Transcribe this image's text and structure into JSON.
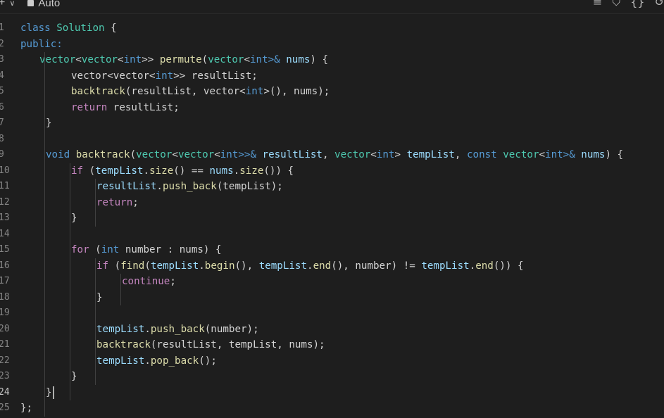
{
  "toolbar": {
    "add_glyph": "+",
    "dropdown_glyph": "∨",
    "language": "Auto",
    "format_glyph": "≡",
    "bookmark_glyph": "⛉",
    "braces_glyph": "{}",
    "reset_glyph": "↺"
  },
  "editor": {
    "active_line": 24,
    "lines": [
      {
        "num": "1",
        "indent": 0,
        "tokens": [
          {
            "t": "class ",
            "c": "kw"
          },
          {
            "t": "Solution",
            "c": "ty"
          },
          {
            "t": " {",
            "c": "pn"
          }
        ]
      },
      {
        "num": "2",
        "indent": 0,
        "tokens": [
          {
            "t": "public:",
            "c": "kw"
          }
        ]
      },
      {
        "num": "3",
        "indent": 3,
        "tokens": [
          {
            "t": "vector",
            "c": "ty"
          },
          {
            "t": "<",
            "c": "pn"
          },
          {
            "t": "vector",
            "c": "ty"
          },
          {
            "t": "<",
            "c": "pn"
          },
          {
            "t": "int",
            "c": "kw"
          },
          {
            "t": ">> ",
            "c": "pn"
          },
          {
            "t": "permute",
            "c": "fn"
          },
          {
            "t": "(",
            "c": "pn"
          },
          {
            "t": "vector",
            "c": "ty"
          },
          {
            "t": "<",
            "c": "pn"
          },
          {
            "t": "int",
            "c": "kw"
          },
          {
            "t": ">& ",
            "c": "kw"
          },
          {
            "t": "nums",
            "c": "var"
          },
          {
            "t": ") {",
            "c": "pn"
          }
        ]
      },
      {
        "num": "4",
        "indent": 8,
        "tokens": [
          {
            "t": "vector",
            "c": "pn"
          },
          {
            "t": "<",
            "c": "pn"
          },
          {
            "t": "vector",
            "c": "pn"
          },
          {
            "t": "<",
            "c": "pn"
          },
          {
            "t": "int",
            "c": "kw"
          },
          {
            "t": ">> resultList;",
            "c": "pn"
          }
        ]
      },
      {
        "num": "5",
        "indent": 8,
        "tokens": [
          {
            "t": "backtrack",
            "c": "fn"
          },
          {
            "t": "(resultList, ",
            "c": "pn"
          },
          {
            "t": "vector",
            "c": "pn"
          },
          {
            "t": "<",
            "c": "pn"
          },
          {
            "t": "int",
            "c": "kw"
          },
          {
            "t": ">(), nums);",
            "c": "pn"
          }
        ]
      },
      {
        "num": "6",
        "indent": 8,
        "tokens": [
          {
            "t": "return",
            "c": "ctl"
          },
          {
            "t": " resultList;",
            "c": "pn"
          }
        ]
      },
      {
        "num": "7",
        "indent": 4,
        "tokens": [
          {
            "t": "}",
            "c": "pn"
          }
        ]
      },
      {
        "num": "8",
        "indent": 0,
        "tokens": []
      },
      {
        "num": "9",
        "indent": 4,
        "tokens": [
          {
            "t": "void ",
            "c": "kw"
          },
          {
            "t": "backtrack",
            "c": "fn"
          },
          {
            "t": "(",
            "c": "pn"
          },
          {
            "t": "vector",
            "c": "ty"
          },
          {
            "t": "<",
            "c": "pn"
          },
          {
            "t": "vector",
            "c": "ty"
          },
          {
            "t": "<",
            "c": "pn"
          },
          {
            "t": "int",
            "c": "kw"
          },
          {
            "t": ">>& ",
            "c": "kw"
          },
          {
            "t": "resultList",
            "c": "var"
          },
          {
            "t": ", ",
            "c": "pn"
          },
          {
            "t": "vector",
            "c": "ty"
          },
          {
            "t": "<",
            "c": "pn"
          },
          {
            "t": "int",
            "c": "kw"
          },
          {
            "t": "> ",
            "c": "pn"
          },
          {
            "t": "tempList",
            "c": "var"
          },
          {
            "t": ", ",
            "c": "pn"
          },
          {
            "t": "const ",
            "c": "kw"
          },
          {
            "t": "vector",
            "c": "ty"
          },
          {
            "t": "<",
            "c": "pn"
          },
          {
            "t": "int",
            "c": "kw"
          },
          {
            "t": ">& ",
            "c": "kw"
          },
          {
            "t": "nums",
            "c": "var"
          },
          {
            "t": ") {",
            "c": "pn"
          }
        ]
      },
      {
        "num": "10",
        "indent": 8,
        "tokens": [
          {
            "t": "if",
            "c": "ctl"
          },
          {
            "t": " (",
            "c": "pn"
          },
          {
            "t": "tempList",
            "c": "var"
          },
          {
            "t": ".",
            "c": "pn"
          },
          {
            "t": "size",
            "c": "fn"
          },
          {
            "t": "() == ",
            "c": "pn"
          },
          {
            "t": "nums",
            "c": "var"
          },
          {
            "t": ".",
            "c": "pn"
          },
          {
            "t": "size",
            "c": "fn"
          },
          {
            "t": "()) {",
            "c": "pn"
          }
        ]
      },
      {
        "num": "11",
        "indent": 12,
        "tokens": [
          {
            "t": "resultList",
            "c": "var"
          },
          {
            "t": ".",
            "c": "pn"
          },
          {
            "t": "push_back",
            "c": "fn"
          },
          {
            "t": "(tempList);",
            "c": "pn"
          }
        ]
      },
      {
        "num": "12",
        "indent": 12,
        "tokens": [
          {
            "t": "return",
            "c": "ctl"
          },
          {
            "t": ";",
            "c": "pn"
          }
        ]
      },
      {
        "num": "13",
        "indent": 8,
        "tokens": [
          {
            "t": "}",
            "c": "pn"
          }
        ]
      },
      {
        "num": "14",
        "indent": 0,
        "tokens": []
      },
      {
        "num": "15",
        "indent": 8,
        "tokens": [
          {
            "t": "for",
            "c": "ctl"
          },
          {
            "t": " (",
            "c": "pn"
          },
          {
            "t": "int",
            "c": "kw"
          },
          {
            "t": " number : nums) {",
            "c": "pn"
          }
        ]
      },
      {
        "num": "16",
        "indent": 12,
        "tokens": [
          {
            "t": "if",
            "c": "ctl"
          },
          {
            "t": " (",
            "c": "pn"
          },
          {
            "t": "find",
            "c": "fn"
          },
          {
            "t": "(",
            "c": "pn"
          },
          {
            "t": "tempList",
            "c": "var"
          },
          {
            "t": ".",
            "c": "pn"
          },
          {
            "t": "begin",
            "c": "fn"
          },
          {
            "t": "(), ",
            "c": "pn"
          },
          {
            "t": "tempList",
            "c": "var"
          },
          {
            "t": ".",
            "c": "pn"
          },
          {
            "t": "end",
            "c": "fn"
          },
          {
            "t": "(), number) != ",
            "c": "pn"
          },
          {
            "t": "tempList",
            "c": "var"
          },
          {
            "t": ".",
            "c": "pn"
          },
          {
            "t": "end",
            "c": "fn"
          },
          {
            "t": "()) {",
            "c": "pn"
          }
        ]
      },
      {
        "num": "17",
        "indent": 16,
        "tokens": [
          {
            "t": "continue",
            "c": "ctl"
          },
          {
            "t": ";",
            "c": "pn"
          }
        ]
      },
      {
        "num": "18",
        "indent": 12,
        "tokens": [
          {
            "t": "}",
            "c": "pn"
          }
        ]
      },
      {
        "num": "19",
        "indent": 0,
        "tokens": []
      },
      {
        "num": "20",
        "indent": 12,
        "tokens": [
          {
            "t": "tempList",
            "c": "var"
          },
          {
            "t": ".",
            "c": "pn"
          },
          {
            "t": "push_back",
            "c": "fn"
          },
          {
            "t": "(number);",
            "c": "pn"
          }
        ]
      },
      {
        "num": "21",
        "indent": 12,
        "tokens": [
          {
            "t": "backtrack",
            "c": "fn"
          },
          {
            "t": "(resultList, tempList, nums);",
            "c": "pn"
          }
        ]
      },
      {
        "num": "22",
        "indent": 12,
        "tokens": [
          {
            "t": "tempList",
            "c": "var"
          },
          {
            "t": ".",
            "c": "pn"
          },
          {
            "t": "pop_back",
            "c": "fn"
          },
          {
            "t": "();",
            "c": "pn"
          }
        ]
      },
      {
        "num": "23",
        "indent": 8,
        "tokens": [
          {
            "t": "}",
            "c": "pn"
          }
        ]
      },
      {
        "num": "24",
        "indent": 4,
        "tokens": [
          {
            "t": "}",
            "c": "pn"
          }
        ]
      },
      {
        "num": "25",
        "indent": 0,
        "tokens": [
          {
            "t": "};",
            "c": "pn"
          }
        ]
      }
    ]
  },
  "colors": {
    "background": "#1e1e1e",
    "keyword": "#569cd6",
    "control": "#c586c0",
    "type": "#4ec9b0",
    "function": "#dcdcaa",
    "variable": "#9cdcfe",
    "plain": "#d4d4d4",
    "line_number": "#858585"
  }
}
